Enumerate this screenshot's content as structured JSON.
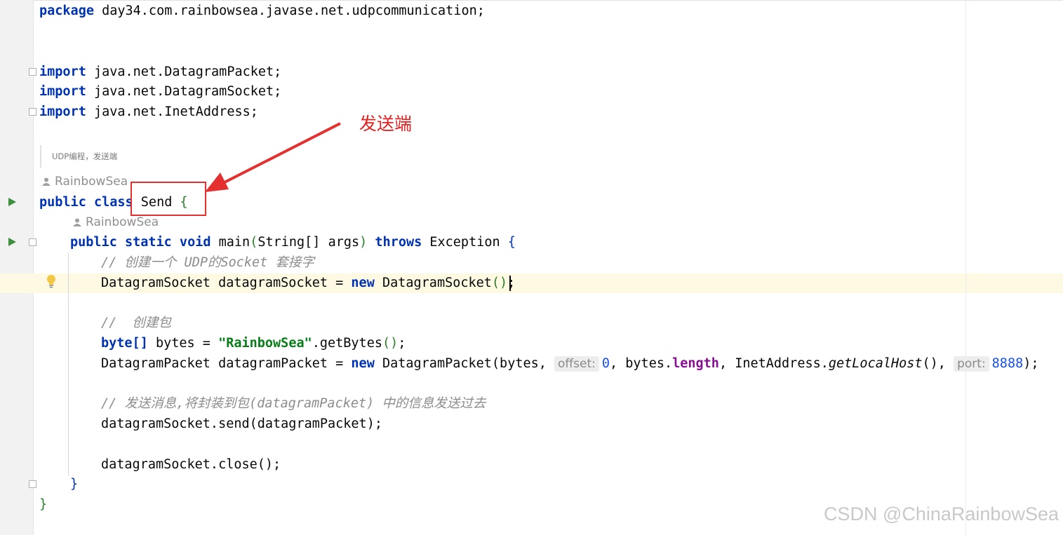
{
  "code": {
    "package_kw": "package",
    "package_name": "day34.com.rainbowsea.javase.net.udpcommunication;",
    "import_kw": "import",
    "imports": [
      "java.net.DatagramPacket;",
      "java.net.DatagramSocket;",
      "java.net.InetAddress;"
    ],
    "doc_comment": "UDP编程，发送端",
    "author_1": "RainbowSea",
    "author_2": "RainbowSea",
    "class_kw": "public class",
    "class_name": "Send",
    "open_brace": "{",
    "main_kw": "public static void",
    "main_name": "main",
    "main_paren_open": "(",
    "main_params": "String[] args",
    "main_paren_close": ")",
    "throws_kw": "throws",
    "exception_name": "Exception",
    "comment_1": "// 创建一个 UDP的Socket 套接字",
    "line_socket_a": "DatagramSocket datagramSocket = ",
    "new_kw": "new",
    "line_socket_b": " DatagramSocket",
    "parens": "()",
    "semicolon": ";",
    "comment_2": "//  创建包",
    "byte_kw": "byte[]",
    "bytes_var": " bytes = ",
    "string_literal": "\"RainbowSea\"",
    "get_bytes": ".getBytes",
    "packet_a": "DatagramPacket datagramPacket = ",
    "packet_b": " DatagramPacket(bytes, ",
    "hint_offset": "offset:",
    "offset_value": "0",
    "packet_c": ", bytes.",
    "length_field": "length",
    "packet_d": ", InetAddress.",
    "get_local_host": "getLocalHost",
    "packet_e": "(), ",
    "hint_port": "port:",
    "port_value": "8888",
    "packet_end": ");",
    "comment_3": "// 发送消息,将封装到包(datagramPacket) 中的信息发送过去",
    "send_line": "datagramSocket.send(datagramPacket);",
    "close_line": "datagramSocket.close();",
    "close_brace": "}"
  },
  "annotation": {
    "label": "发送端",
    "color": "#e31f1f"
  },
  "watermark": "CSDN @ChinaRainbowSea",
  "colors": {
    "keyword": "#0033b3",
    "string": "#067d17",
    "comment": "#8c8c8c",
    "number": "#1750eb",
    "field": "#871094",
    "current_line": "#fdf9e3"
  },
  "icons": [
    "run-icon",
    "fold-icon",
    "person-icon",
    "bulb-icon",
    "arrow"
  ]
}
